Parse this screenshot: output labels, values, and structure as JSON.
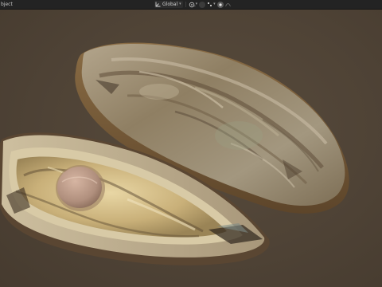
{
  "header": {
    "menu_label": "bject",
    "orientation_label": "Global",
    "icons": [
      "transform-orientation-icon",
      "chevron-down-icon",
      "pivot-point-icon",
      "snap-icon",
      "snap-increment-icon",
      "proportional-edit-icon",
      "proportional-falloff-icon"
    ]
  },
  "viewport": {
    "background_color": "#4f4336",
    "objects": [
      "oyster-shell-closed",
      "oyster-shell-open"
    ]
  },
  "colors": {
    "header_bg": "#232323",
    "viewport_bg": "#4f4336"
  }
}
